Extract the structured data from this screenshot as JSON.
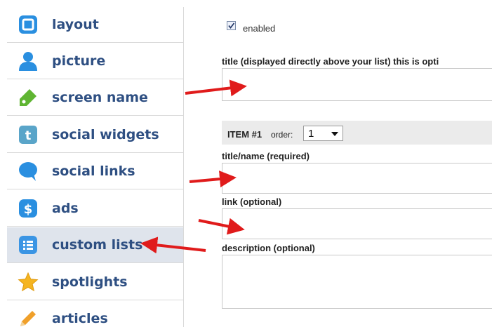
{
  "sidebar": {
    "items": [
      {
        "label": "layout",
        "icon": "layout-icon"
      },
      {
        "label": "picture",
        "icon": "person-icon"
      },
      {
        "label": "screen name",
        "icon": "tag-icon"
      },
      {
        "label": "social widgets",
        "icon": "twitter-icon"
      },
      {
        "label": "social links",
        "icon": "speech-bubble-icon"
      },
      {
        "label": "ads",
        "icon": "dollar-icon"
      },
      {
        "label": "custom lists",
        "icon": "list-icon"
      },
      {
        "label": "spotlights",
        "icon": "star-icon"
      },
      {
        "label": "articles",
        "icon": "pencil-icon"
      }
    ],
    "active_item": "custom lists"
  },
  "form": {
    "enabled_label": "enabled",
    "enabled_checked": true,
    "title_label": "title (displayed directly above your list) this is opti",
    "item_label": "ITEM #1",
    "order_label": "order:",
    "order_value": "1",
    "name_label": "title/name (required)",
    "link_label": "link (optional)",
    "description_label": "description (optional)"
  },
  "colors": {
    "sidebar_text": "#2e4f82",
    "active_bg": "#dfe4ec",
    "arrow_red": "#e01b1b"
  }
}
